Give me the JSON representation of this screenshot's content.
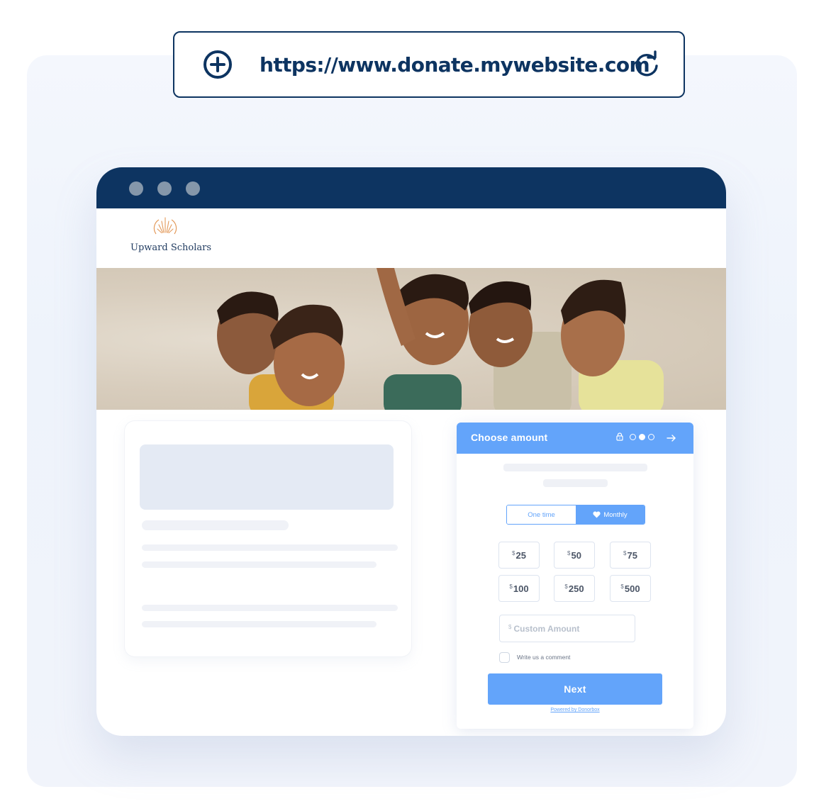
{
  "address_bar": {
    "url": "https://www.donate.mywebsite.com",
    "left_icon": "add-circle-icon",
    "right_icon": "reload-icon"
  },
  "window": {
    "dots": [
      "close",
      "minimize",
      "maximize"
    ],
    "colors": {
      "titlebar": "#0d3461",
      "accent": "#63a4fa"
    }
  },
  "site": {
    "logo_icon": "sunburst-logo-icon",
    "name": "Upward Scholars",
    "hero_image": "smiling children photo"
  },
  "donation_form": {
    "title": "Choose amount",
    "steps": {
      "total": 3,
      "current": 2
    },
    "frequency_options": [
      {
        "label": "One time",
        "selected": false
      },
      {
        "label": "Monthly",
        "selected": true,
        "icon": "heart-icon"
      }
    ],
    "currency_symbol": "$",
    "amounts": [
      "25",
      "50",
      "75",
      "100",
      "250",
      "500"
    ],
    "custom_amount_placeholder": "Custom Amount",
    "comment_label": "Write us a comment",
    "comment_checked": false,
    "next_label": "Next",
    "powered_by": "Powered by Donorbox"
  }
}
